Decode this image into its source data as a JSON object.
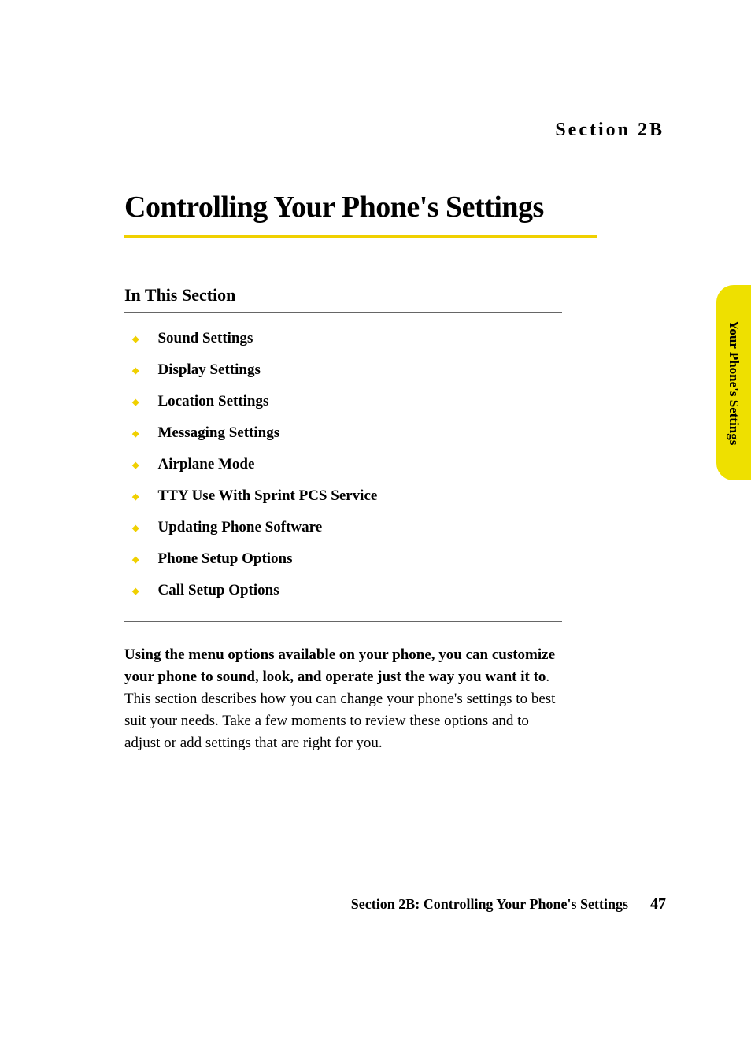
{
  "section_label": "Section 2B",
  "main_heading": "Controlling Your Phone's Settings",
  "subheading": "In This Section",
  "bullets": [
    "Sound Settings",
    "Display Settings",
    "Location Settings",
    "Messaging Settings",
    "Airplane Mode",
    "TTY Use With Sprint PCS Service",
    "Updating Phone Software",
    "Phone Setup Options",
    "Call Setup Options"
  ],
  "body_bold": "Using the menu options available on your phone, you can customize your phone to sound, look, and operate just the way you want it to",
  "body_rest": ". This section describes how you can change your phone's settings to best suit your needs. Take a few moments to review these options and to adjust or add settings that are right for you.",
  "side_tab": "Your Phone's Settings",
  "footer_text": "Section 2B: Controlling Your Phone's Settings",
  "page_number": "47"
}
